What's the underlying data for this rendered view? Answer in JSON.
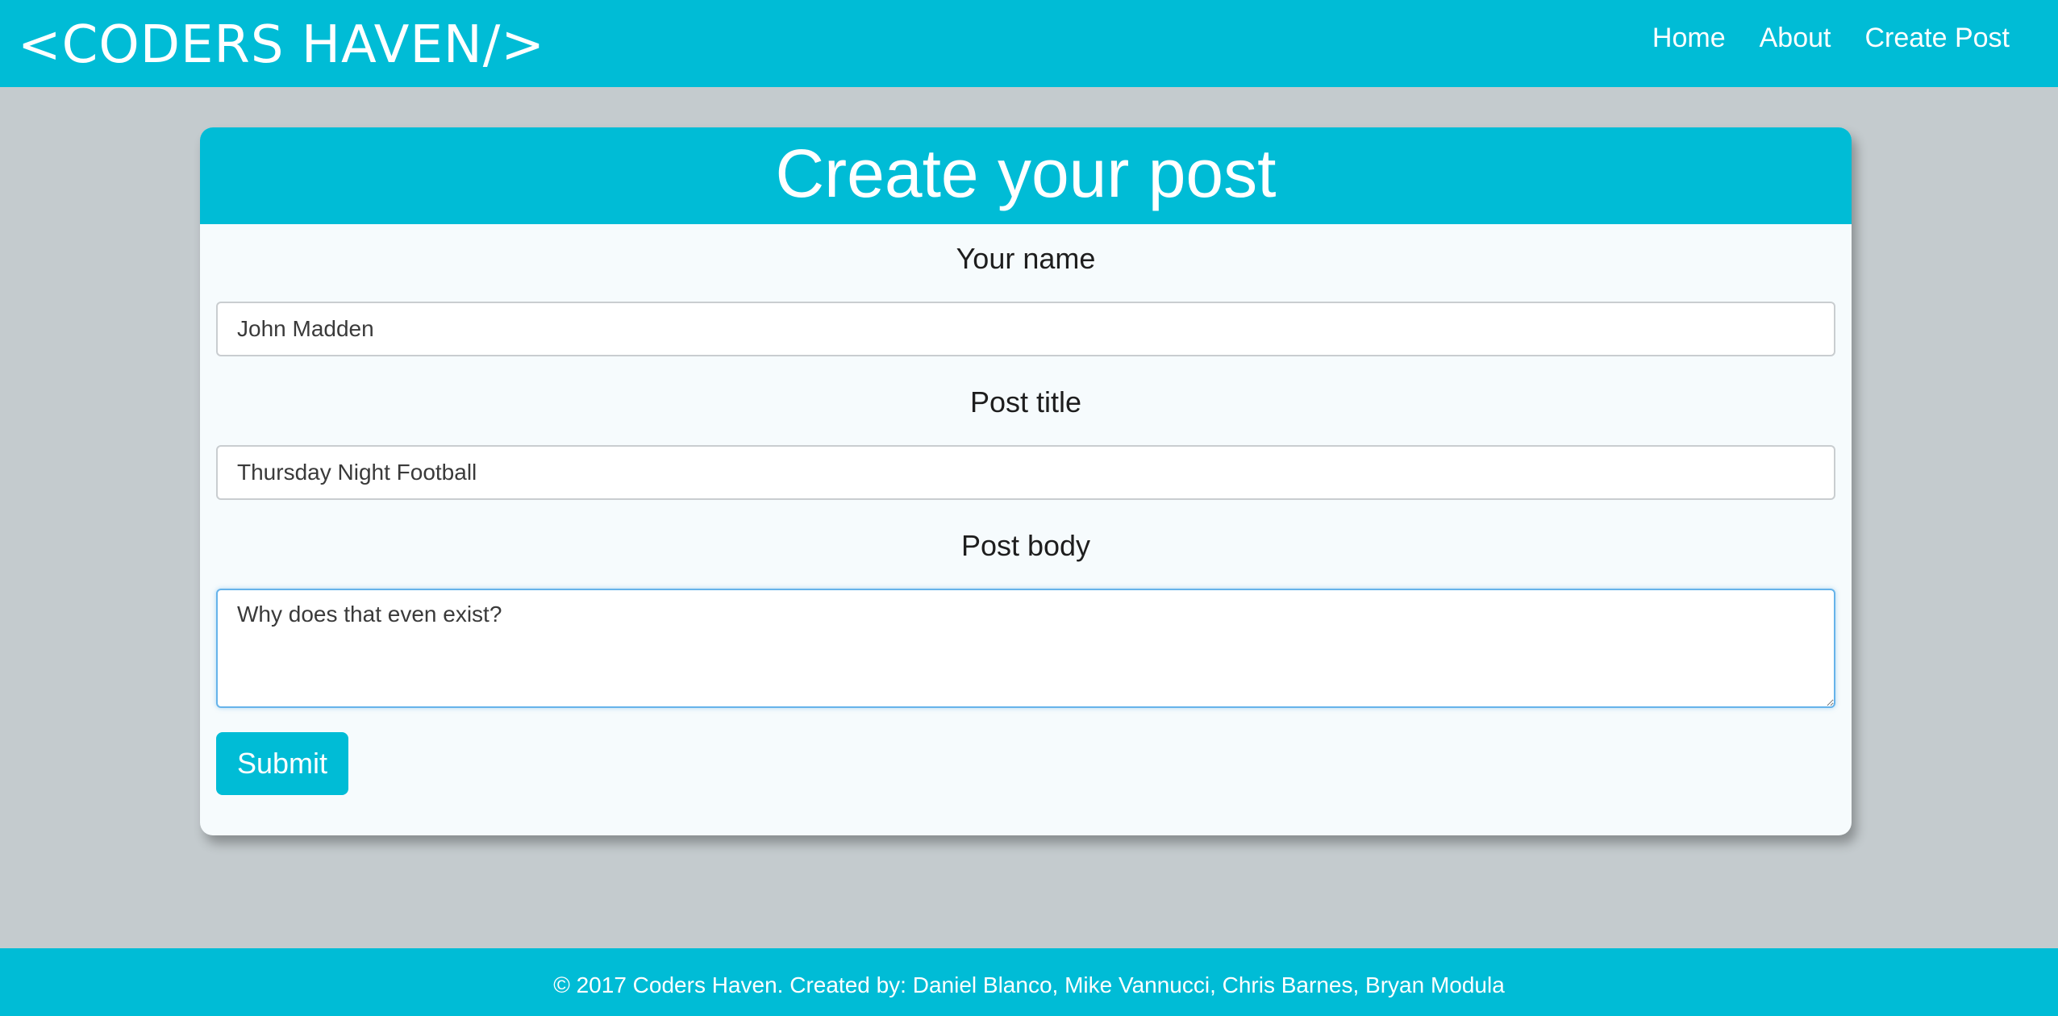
{
  "nav": {
    "brand": "<CODERS HAVEN/>",
    "links": [
      {
        "label": "Home"
      },
      {
        "label": "About"
      },
      {
        "label": "Create Post"
      }
    ]
  },
  "form": {
    "title": "Create your post",
    "name_label": "Your name",
    "name_value": "John Madden",
    "title_label": "Post title",
    "title_value": "Thursday Night Football",
    "body_label": "Post body",
    "body_value": "Why does that even exist?",
    "submit_label": "Submit"
  },
  "footer": {
    "text": "© 2017 Coders Haven. Created by: Daniel Blanco, Mike Vannucci, Chris Barnes, Bryan Modula"
  },
  "colors": {
    "accent": "#00bcd6",
    "page_background": "#c4cbce",
    "card_background": "#f6fbfd",
    "focus_border": "#66b3ea"
  }
}
